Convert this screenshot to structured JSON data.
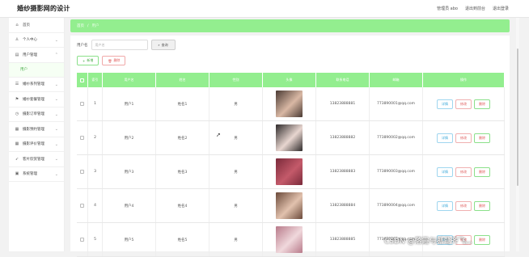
{
  "app_title": "婚纱摄影网的设计",
  "top_links": {
    "admin": "管理员 abo",
    "backend": "退出到前台",
    "logout": "退出登录"
  },
  "sidebar": {
    "items": [
      {
        "label": "首页",
        "icon": "home-icon",
        "glyph": "⌂"
      },
      {
        "label": "个人中心",
        "icon": "user-icon",
        "glyph": "♙"
      },
      {
        "label": "用户管理",
        "icon": "users-icon",
        "glyph": "▤"
      },
      {
        "label": "婚纱系列管理",
        "icon": "list-icon",
        "glyph": "☰"
      },
      {
        "label": "婚纱套餐管理",
        "icon": "flag-icon",
        "glyph": "⚑"
      },
      {
        "label": "摄影订单管理",
        "icon": "clock-icon",
        "glyph": "◷"
      },
      {
        "label": "摄影预约管理",
        "icon": "grid-icon",
        "glyph": "▦"
      },
      {
        "label": "摄影评价管理",
        "icon": "grid2-icon",
        "glyph": "▦"
      },
      {
        "label": "客片欣赏管理",
        "icon": "send-icon",
        "glyph": "➶"
      },
      {
        "label": "系统管理",
        "icon": "settings-icon",
        "glyph": "▣"
      }
    ],
    "sub_item": "用户"
  },
  "breadcrumb": {
    "home": "首页",
    "separator": "/",
    "current": "用户"
  },
  "search": {
    "label": "用户名",
    "placeholder": "用户名",
    "button": "查询"
  },
  "actions": {
    "add": "新增",
    "delete": "删除"
  },
  "table": {
    "headers": [
      "",
      "索引",
      "用户名",
      "姓名",
      "性别",
      "头像",
      "联系电话",
      "邮箱",
      "操作"
    ],
    "rows": [
      {
        "index": "1",
        "username": "用户1",
        "name": "姓名1",
        "gender": "男",
        "phone": "13823888881",
        "email": "773890001@qq.com",
        "photo_colors": [
          "#4a3a33",
          "#d9b8a4"
        ]
      },
      {
        "index": "2",
        "username": "用户2",
        "name": "姓名2",
        "gender": "男",
        "phone": "13823888882",
        "email": "773890002@qq.com",
        "photo_colors": [
          "#2e2a2a",
          "#e8d6d0"
        ]
      },
      {
        "index": "3",
        "username": "用户3",
        "name": "姓名3",
        "gender": "男",
        "phone": "13823888883",
        "email": "773890003@qq.com",
        "photo_colors": [
          "#7a2a3a",
          "#c45a6a"
        ]
      },
      {
        "index": "4",
        "username": "用户4",
        "name": "姓名4",
        "gender": "男",
        "phone": "13823888884",
        "email": "773890004@qq.com",
        "photo_colors": [
          "#6b4a3a",
          "#e2c2ae"
        ]
      },
      {
        "index": "5",
        "username": "用户5",
        "name": "姓名5",
        "gender": "男",
        "phone": "13823888885",
        "email": "773890005@qq.com",
        "photo_colors": [
          "#b87a8a",
          "#f0d8dc"
        ]
      }
    ],
    "ops": {
      "detail": "详情",
      "edit": "修改",
      "delete": "删除"
    }
  },
  "watermark": "CSDN @落霞与孤鹜齐飞。。",
  "colors": {
    "accent": "#93ee8f",
    "accent_text": "#4cae4c",
    "danger": "#e05a5a",
    "info": "#3aa8d8"
  }
}
